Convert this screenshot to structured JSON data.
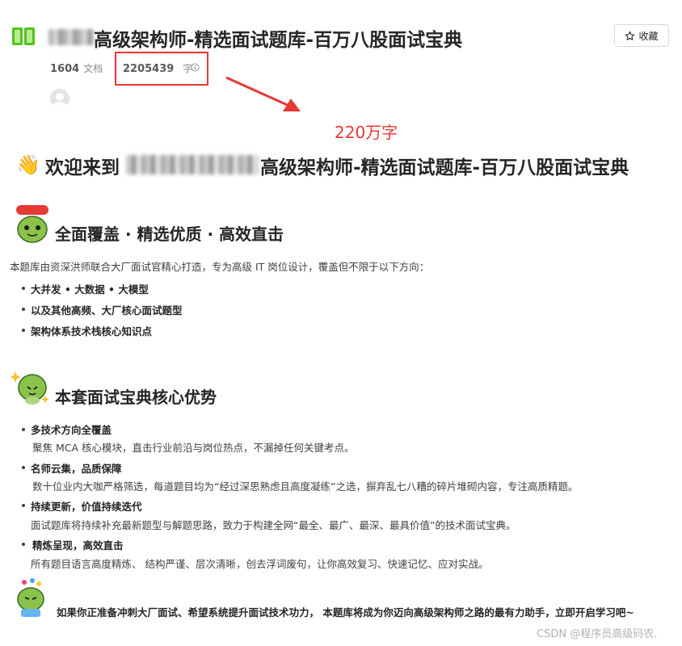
{
  "header": {
    "title": "高级架构师-精选面试题库-百万八股面试宝典",
    "favorite_label": "收藏",
    "doc_count": "1604",
    "doc_unit": "文档",
    "word_count": "2205439",
    "word_unit": "字"
  },
  "annotation": "220万字",
  "welcome": {
    "prefix": "欢迎来到",
    "suffix": "高级架构师-精选面试题库-百万八股面试宝典"
  },
  "section1": {
    "heading": "全面覆盖 · 精选优质 · 高效直击",
    "intro": "本题库由资深洪师联合大厂面试官精心打造，专为高级 IT 岗位设计，覆盖但不限于以下方向：",
    "items": [
      "大并发 • 大数据 • 大模型",
      "以及其他高频、大厂核心面试题型",
      "架构体系技术栈核心知识点"
    ]
  },
  "section2": {
    "heading": "本套面试宝典核心优势",
    "items": [
      {
        "title": "多技术方向全覆盖",
        "desc": "聚焦 MCA 核心模块，直击行业前沿与岗位热点，不漏掉任何关键考点。"
      },
      {
        "title": "名师云集，品质保障",
        "desc": "数十位业内大咖严格筛选，每道题目均为“经过深思熟虑且高度凝练”之选，摒弃乱七八糟的碎片堆砌内容，专注高质精题。"
      },
      {
        "title": "持续更新，价值持续迭代",
        "desc": "面试题库将持续补充最新题型与解题思路，致力于构建全网“最全、最广、最深、最具价值”的技术面试宝典。"
      },
      {
        "title": "精炼呈现，高效直击",
        "desc": "所有题目语言高度精炼、 结构严谨、层次清晰，创去浮词废句，让你高效复习、快速记忆、应对实战。"
      }
    ]
  },
  "footer": {
    "cta": "如果你正准备冲刺大厂面试、希望系统提升面试技术功力， 本题库将成为你迈向高级架构师之路的最有力助手，立即开启学习吧~",
    "watermark": "CSDN @程序员高级码农."
  },
  "icons": {
    "book": "book-icon",
    "star": "star-icon",
    "info": "info-icon",
    "wave": "waving-hand-icon",
    "arrow": "red-arrow"
  },
  "colors": {
    "accent_red": "#e53935",
    "book_green": "#52c41a",
    "sticker_green": "#8bc34a"
  }
}
